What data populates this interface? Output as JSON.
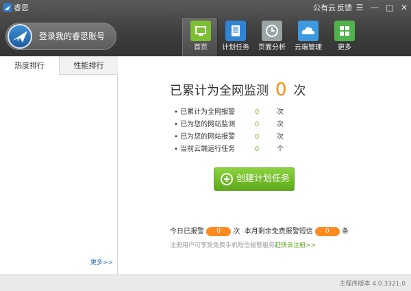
{
  "app": {
    "title": "睿思",
    "titlebar_links": [
      "公有云",
      "反馈"
    ],
    "window_controls": [
      "menu-icon",
      "minimize-icon",
      "maximize-icon",
      "close-icon"
    ]
  },
  "login": {
    "label": "登录我的睿思账号"
  },
  "nav": [
    {
      "label": "首页",
      "icon": "monitor-icon",
      "color": "#7dbf32",
      "active": true
    },
    {
      "label": "计划任务",
      "icon": "clipboard-icon",
      "color": "#2f84d4",
      "active": false
    },
    {
      "label": "页面分析",
      "icon": "clock-icon",
      "color": "#9aa4a6",
      "active": false
    },
    {
      "label": "云端管理",
      "icon": "cloud-icon",
      "color": "#3c9be0",
      "active": false
    },
    {
      "label": "更多",
      "icon": "grid-icon",
      "color": "#4fb24a",
      "active": false
    }
  ],
  "sidebar": {
    "tabs": [
      "热度排行",
      "性能排行"
    ],
    "more": "更多>>"
  },
  "main": {
    "headline_prefix": "已累计为全网监测",
    "headline_value": "0",
    "headline_unit": "次",
    "stats": [
      {
        "label": "• 已累计为全网报警",
        "value": "0",
        "unit": "次"
      },
      {
        "label": "• 已为您的网站监测",
        "value": "0",
        "unit": "次"
      },
      {
        "label": "• 已为您的网站报警",
        "value": "0",
        "unit": "次"
      },
      {
        "label": "• 当前云端运行任务",
        "value": "0",
        "unit": "个"
      }
    ],
    "create_button": "创建计划任务",
    "today_alarm_label": "今日已报警",
    "today_alarm_value": "0",
    "today_alarm_unit": "次",
    "sms_label": "本月剩余免费报警短信",
    "sms_value": "0",
    "sms_unit": "条",
    "hint_text": "注册用户可享受免费手机短信报警服务",
    "hint_link": "赶快去注册>>"
  },
  "status": {
    "version": "主程序版本 4.0.3321.0"
  },
  "colors": {
    "accent_orange": "#ff8a00",
    "accent_green": "#7bbd3a"
  }
}
